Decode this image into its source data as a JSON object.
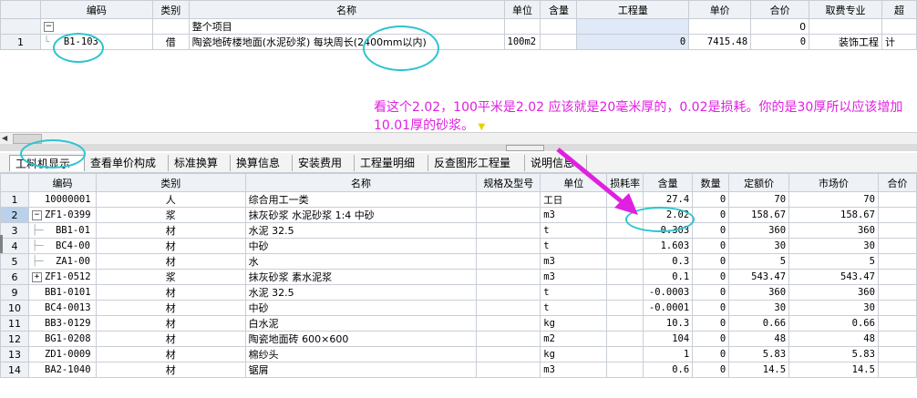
{
  "top_table": {
    "columns": [
      "",
      "编码",
      "类别",
      "名称",
      "单位",
      "含量",
      "工程量",
      "单价",
      "合价",
      "取费专业",
      "超"
    ],
    "group_row": {
      "toggle": "−",
      "name": "整个项目",
      "total": "0"
    },
    "rows": [
      {
        "num": "1",
        "code": "B1-103",
        "type": "借",
        "name": "陶瓷地砖楼地面(水泥砂浆) 每块周长(2400mm以内)",
        "unit": "100m2",
        "content": "",
        "qty": "0",
        "price": "7415.48",
        "total": "0",
        "fee": "装饰工程",
        "extra": "计"
      }
    ]
  },
  "tabs": [
    "工料机显示",
    "查看单价构成",
    "标准换算",
    "换算信息",
    "安装费用",
    "工程量明细",
    "反查图形工程量",
    "说明信息"
  ],
  "bottom_table": {
    "columns": [
      "",
      "编码",
      "类别",
      "名称",
      "规格及型号",
      "单位",
      "损耗率",
      "含量",
      "数量",
      "定额价",
      "市场价",
      "合价"
    ],
    "rows": [
      {
        "num": "1",
        "toggle": "",
        "code": "10000001",
        "type": "人",
        "name": "综合用工一类",
        "spec": "",
        "unit": "工日",
        "loss": "",
        "content": "27.4",
        "qty": "0",
        "quota": "70",
        "market": "70"
      },
      {
        "num": "2",
        "toggle": "−",
        "code": "ZF1-0399",
        "type": "浆",
        "name": "抹灰砂浆 水泥砂浆 1:4 中砂",
        "spec": "",
        "unit": "m3",
        "loss": "",
        "content": "2.02",
        "qty": "0",
        "quota": "158.67",
        "market": "158.67"
      },
      {
        "num": "3",
        "toggle": "",
        "code": "BB1-01",
        "type": "材",
        "name": "水泥 32.5",
        "spec": "",
        "unit": "t",
        "loss": "",
        "content": "0.303",
        "qty": "0",
        "quota": "360",
        "market": "360"
      },
      {
        "num": "4",
        "toggle": "",
        "code": "BC4-00",
        "type": "材",
        "name": "中砂",
        "spec": "",
        "unit": "t",
        "loss": "",
        "content": "1.603",
        "qty": "0",
        "quota": "30",
        "market": "30"
      },
      {
        "num": "5",
        "toggle": "",
        "code": "ZA1-00",
        "type": "材",
        "name": "水",
        "spec": "",
        "unit": "m3",
        "loss": "",
        "content": "0.3",
        "qty": "0",
        "quota": "5",
        "market": "5"
      },
      {
        "num": "6",
        "toggle": "+",
        "code": "ZF1-0512",
        "type": "浆",
        "name": "抹灰砂浆 素水泥浆",
        "spec": "",
        "unit": "m3",
        "loss": "",
        "content": "0.1",
        "qty": "0",
        "quota": "543.47",
        "market": "543.47"
      },
      {
        "num": "9",
        "toggle": "",
        "code": "BB1-0101",
        "type": "材",
        "name": "水泥 32.5",
        "spec": "",
        "unit": "t",
        "loss": "",
        "content": "-0.0003",
        "qty": "0",
        "quota": "360",
        "market": "360"
      },
      {
        "num": "10",
        "toggle": "",
        "code": "BC4-0013",
        "type": "材",
        "name": "中砂",
        "spec": "",
        "unit": "t",
        "loss": "",
        "content": "-0.0001",
        "qty": "0",
        "quota": "30",
        "market": "30"
      },
      {
        "num": "11",
        "toggle": "",
        "code": "BB3-0129",
        "type": "材",
        "name": "白水泥",
        "spec": "",
        "unit": "kg",
        "loss": "",
        "content": "10.3",
        "qty": "0",
        "quota": "0.66",
        "market": "0.66"
      },
      {
        "num": "12",
        "toggle": "",
        "code": "BG1-0208",
        "type": "材",
        "name": "陶瓷地面砖 600×600",
        "spec": "",
        "unit": "m2",
        "loss": "",
        "content": "104",
        "qty": "0",
        "quota": "48",
        "market": "48"
      },
      {
        "num": "13",
        "toggle": "",
        "code": "ZD1-0009",
        "type": "材",
        "name": "棉纱头",
        "spec": "",
        "unit": "kg",
        "loss": "",
        "content": "1",
        "qty": "0",
        "quota": "5.83",
        "market": "5.83"
      },
      {
        "num": "14",
        "toggle": "",
        "code": "BA2-1040",
        "type": "材",
        "name": "锯屑",
        "spec": "",
        "unit": "m3",
        "loss": "",
        "content": "0.6",
        "qty": "0",
        "quota": "14.5",
        "market": "14.5"
      }
    ]
  },
  "annotation": {
    "text": "看这个2.02，100平米是2.02 应该就是20毫米厚的，0.02是损耗。你的是30厚所以应该增加10.01厚的砂浆。",
    "marker": "▼",
    "color": "#e020e0",
    "circle_color": "#2cc4d0"
  }
}
